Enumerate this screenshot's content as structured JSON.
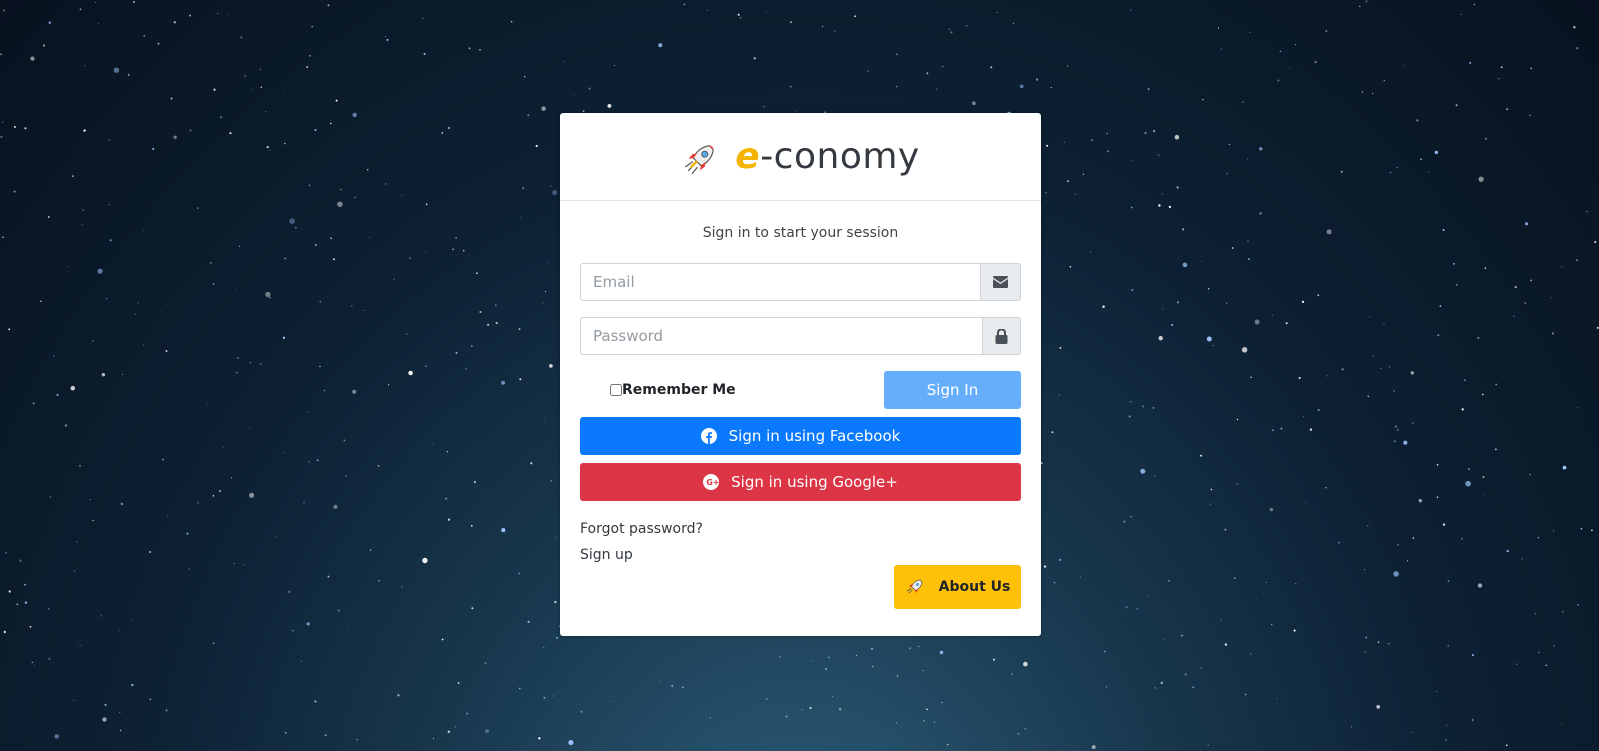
{
  "brand": {
    "name_prefix": "e",
    "name_rest": "-conomy",
    "icon": "rocket-icon"
  },
  "login": {
    "message": "Sign in to start your session",
    "email_placeholder": "Email",
    "password_placeholder": "Password",
    "remember_label": "Remember Me",
    "signin_label": "Sign In"
  },
  "social": {
    "facebook_label": "Sign in using Facebook",
    "google_label": "Sign in using Google+"
  },
  "links": {
    "forgot": "Forgot password?",
    "signup": "Sign up"
  },
  "about": {
    "label": "About Us"
  },
  "colors": {
    "accent": "#ffc107",
    "facebook": "#0b79fb",
    "google": "#dc3545",
    "signin": "#66aefc"
  }
}
